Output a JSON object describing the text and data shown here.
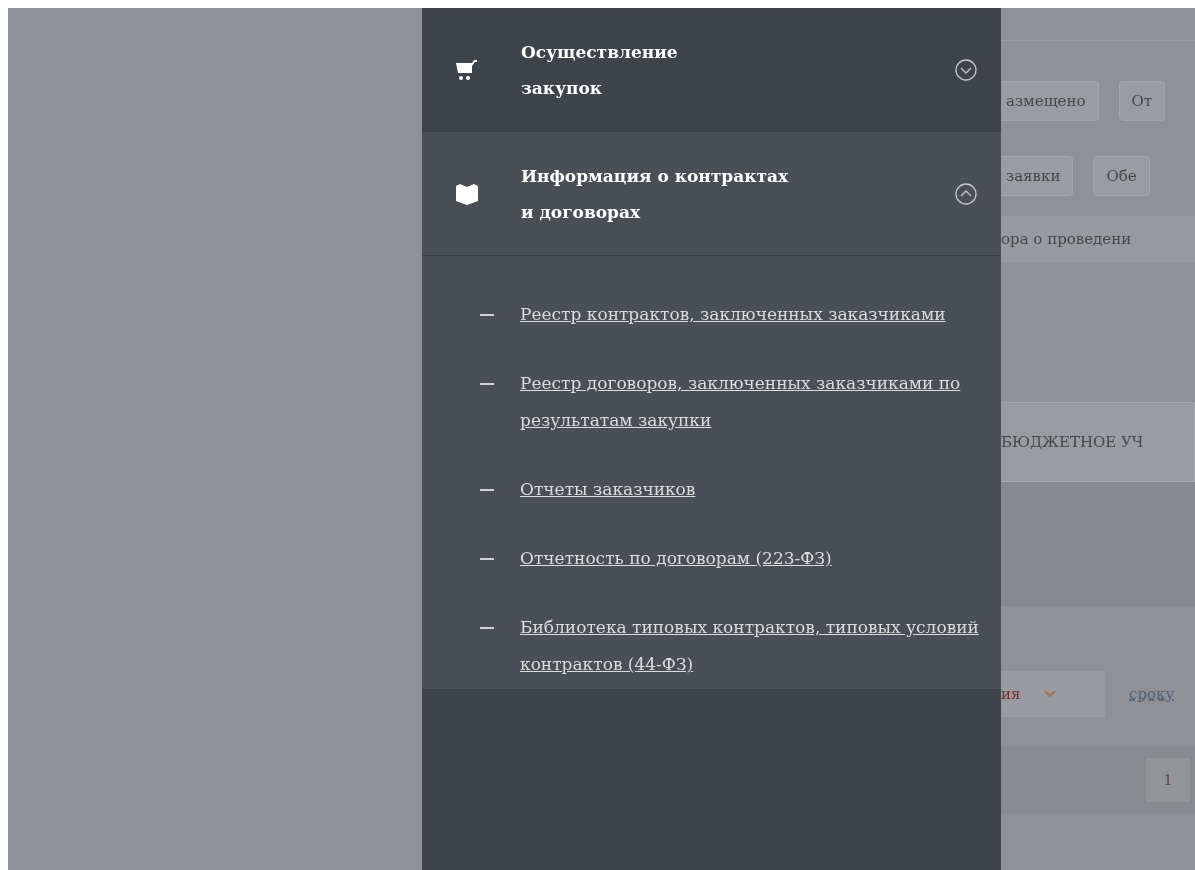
{
  "menu": {
    "sections": [
      {
        "title": "Осуществление\nзакупок",
        "expanded": false
      },
      {
        "title": "Информация о контрактах\nи договорах",
        "expanded": true,
        "links": [
          "Реестр контрактов, заключенных заказчиками",
          "Реестр договоров, заключенных заказчиками по результатам закупки",
          "Отчеты заказчиков",
          "Отчетность по договорам (223-ФЗ)",
          "Библиотека типовых контрактов, типовых условий контрактов (44-ФЗ)"
        ]
      }
    ]
  },
  "background_page": {
    "filter_buttons_row_1": [
      "азмещено",
      "От"
    ],
    "filter_buttons_row_2": [
      "заявки",
      "Обе"
    ],
    "filter_text": "ора о проведени",
    "customer_field": {
      "value": "БЮДЖЕТНОЕ УЧ"
    },
    "sort_select": {
      "value": "ия"
    },
    "sort_link": "сроку",
    "pagination": [
      "1"
    ]
  }
}
